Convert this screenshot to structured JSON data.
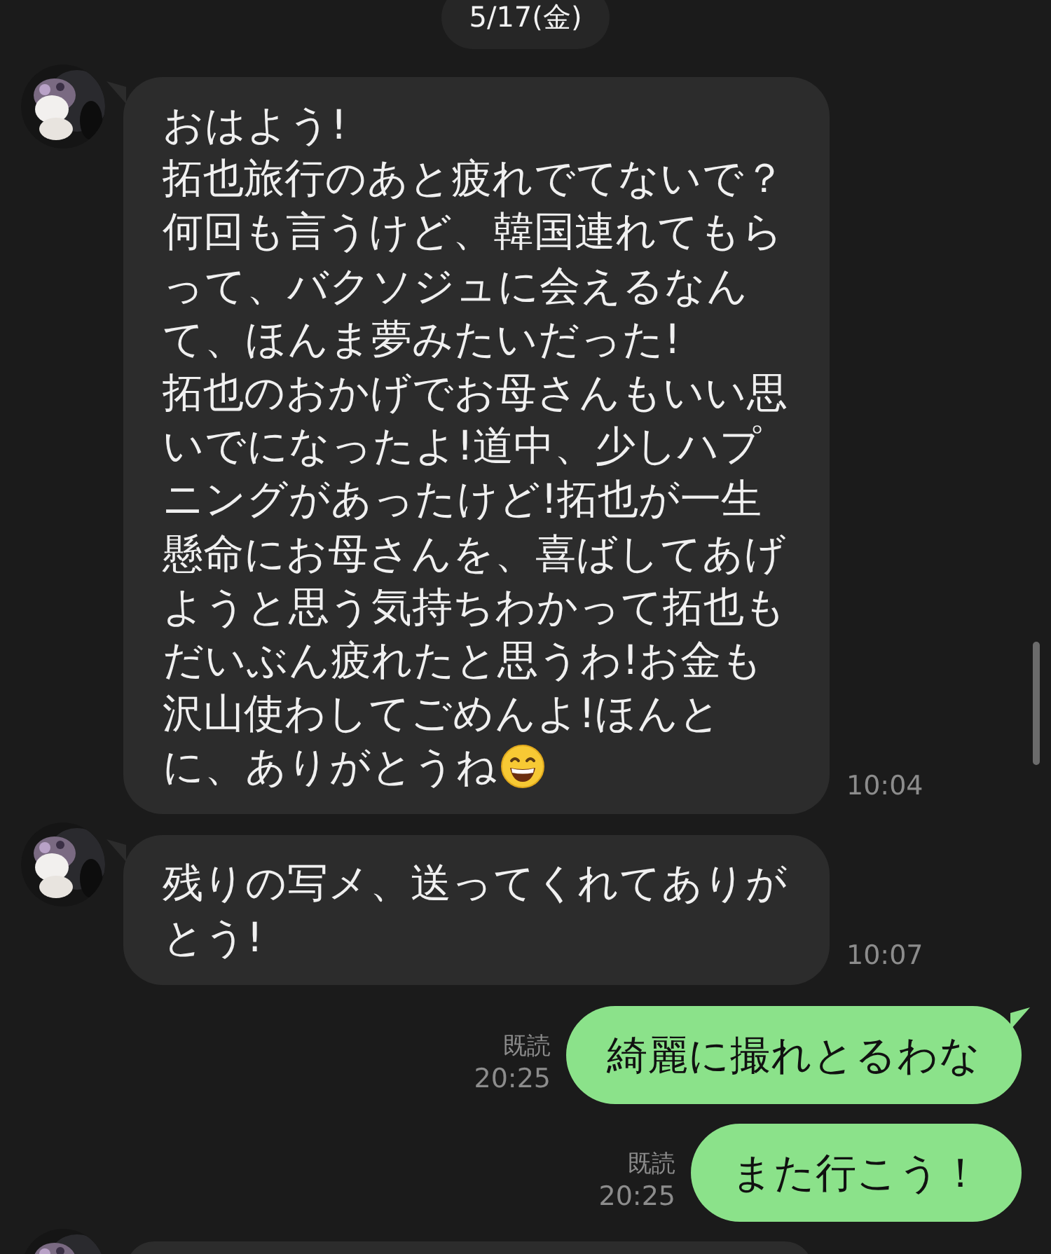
{
  "date": "5/17(金)",
  "messages": [
    {
      "kind": "incoming",
      "lines": [
        "おはよう!",
        "拓也旅行のあと疲れでてないで？",
        "何回も言うけど、韓国連れてもら",
        "って、バクソジュに会えるなん",
        "て、ほんま夢みたいだった!",
        "拓也のおかげでお母さんもいい思",
        "いでになったよ!道中、少しハプ",
        "ニングがあったけど!拓也が一生",
        "懸命にお母さんを、喜ばしてあげ",
        "ようと思う気持ちわかって拓也も",
        "だいぶん疲れたと思うわ!お金も",
        "沢山使わしてごめんよ!ほんと",
        "に、ありがとうね"
      ],
      "end_icon": {
        "kind": "grin"
      },
      "time": "10:04"
    },
    {
      "kind": "incoming",
      "lines": [
        "残りの写メ、送ってくれてありが",
        "とう!"
      ],
      "time": "10:07"
    },
    {
      "kind": "outgoing",
      "text": "綺麗に撮れとるわな",
      "read": "既読",
      "time": "20:25",
      "tail": true
    },
    {
      "kind": "outgoing",
      "text": "また行こう！",
      "read": "既読",
      "time": "20:25",
      "tail": false
    },
    {
      "kind": "incoming_cut"
    }
  ]
}
